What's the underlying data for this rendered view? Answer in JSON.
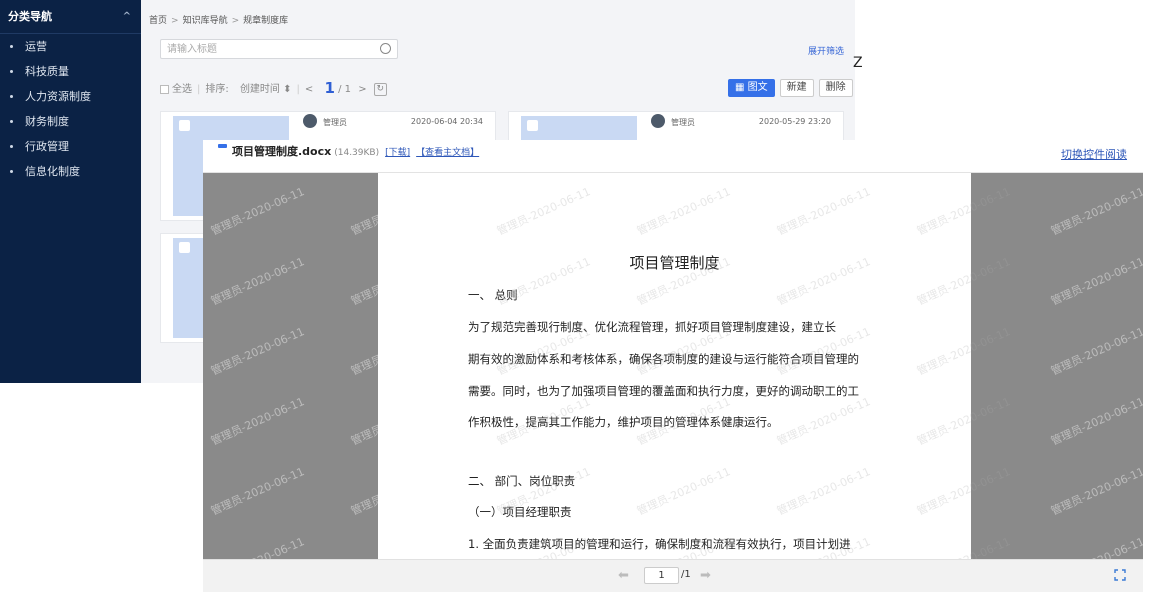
{
  "sidebar": {
    "title": "分类导航",
    "items": [
      {
        "label": "运营"
      },
      {
        "label": "科技质量"
      },
      {
        "label": "人力资源制度"
      },
      {
        "label": "财务制度"
      },
      {
        "label": "行政管理"
      },
      {
        "label": "信息化制度"
      }
    ]
  },
  "breadcrumb": [
    "首页",
    "知识库导航",
    "规章制度库"
  ],
  "search": {
    "placeholder": "请输入标题"
  },
  "expand_filter": "展开筛选",
  "toolbar": {
    "select_all": "全选",
    "sort_label": "排序:",
    "sort_field": "创建时间",
    "page_current": "1",
    "page_total": "/ 1"
  },
  "actions": {
    "view_mode": "图文",
    "new": "新建",
    "delete": "删除"
  },
  "cards": [
    {
      "author": "管理员",
      "date": "2020-06-04 20:34"
    },
    {
      "author": "管理员",
      "date": "2020-05-29 23:20"
    }
  ],
  "stray_char": "Z",
  "viewer": {
    "file_name": "项目管理制度.docx",
    "file_size": "(14.39KB)",
    "download": "[下载]",
    "view_main": "【查看主文档】",
    "switch_control": "切换控件阅读",
    "watermark": "管理员-2020-06-11",
    "doc_title": "项目管理制度",
    "lines": [
      "一、    总则",
      "        为了规范完善现行制度、优化流程管理，抓好项目管理制度建设，建立长",
      "期有效的激励体系和考核体系，确保各项制度的建设与运行能符合项目管理的",
      "需要。同时，也为了加强项目管理的覆盖面和执行力度，更好的调动职工的工",
      "作积极性，提高其工作能力，维护项目的管理体系健康运行。",
      "二、     部门、岗位职责",
      "（一）项目经理职责",
      "1.  全面负责建筑项目的管理和运行，确保制度和流程有效执行，项目计划进"
    ],
    "page_input": "1",
    "page_total": "/1"
  }
}
